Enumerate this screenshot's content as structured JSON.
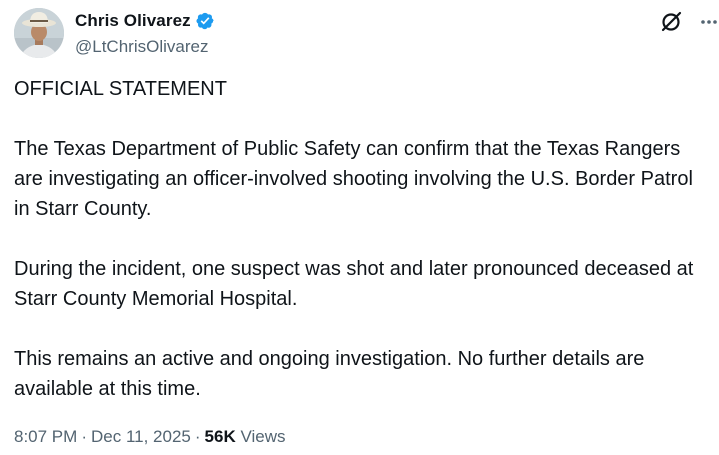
{
  "author": {
    "display_name": "Chris Olivarez",
    "handle": "@LtChrisOlivarez",
    "verified": true,
    "badge_color": "#1d9bf0"
  },
  "actions": {
    "grok_icon": "grok-icon",
    "more_icon": "more-icon"
  },
  "tweet": {
    "paragraphs": [
      "OFFICIAL STATEMENT",
      "The Texas Department of Public Safety can confirm that the Texas Rangers are investigating an officer-involved shooting involving the U.S. Border Patrol in Starr County.",
      "During the incident, one suspect was shot and later pronounced deceased at Starr County Memorial Hospital.",
      "This remains an active and ongoing investigation. No further details are available at this time."
    ]
  },
  "meta": {
    "time": "8:07 PM",
    "separator": "·",
    "date": "Dec 11, 2025",
    "views_count": "56K",
    "views_label": "Views"
  }
}
